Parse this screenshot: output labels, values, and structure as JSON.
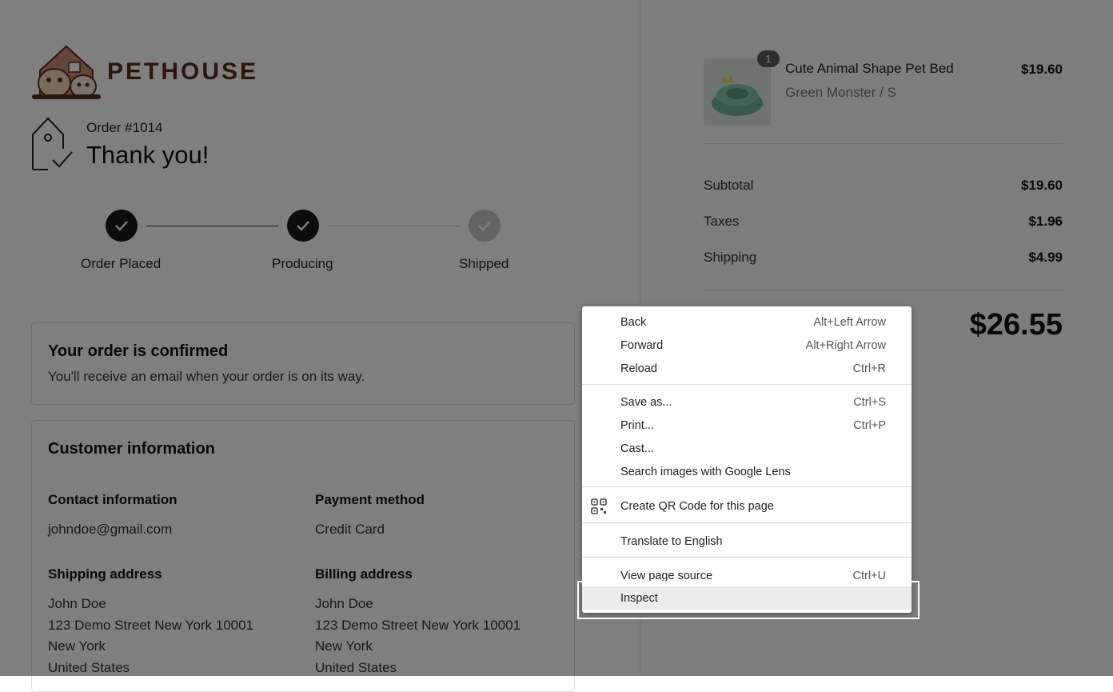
{
  "brand": {
    "name": "PETHOUSE"
  },
  "order": {
    "number": "Order #1014",
    "thanks": "Thank you!"
  },
  "progress": [
    {
      "label": "Order Placed",
      "done": true
    },
    {
      "label": "Producing",
      "done": true
    },
    {
      "label": "Shipped",
      "done": false
    }
  ],
  "confirm": {
    "title": "Your order is confirmed",
    "text": "You'll receive an email when your order is on its way."
  },
  "customer": {
    "title": "Customer information",
    "contact": {
      "heading": "Contact information",
      "value": "johndoe@gmail.com"
    },
    "payment": {
      "heading": "Payment method",
      "value": "Credit Card"
    },
    "shipping": {
      "heading": "Shipping address",
      "lines": [
        "John Doe",
        "123 Demo Street New York 10001",
        "New York",
        "United States"
      ]
    },
    "billing": {
      "heading": "Billing address",
      "lines": [
        "John Doe",
        "123 Demo Street New York 10001",
        "New York",
        "United States"
      ]
    }
  },
  "summary": {
    "item": {
      "name": "Cute Animal Shape Pet Bed",
      "variant": "Green Monster / S",
      "price": "$19.60",
      "qty": "1"
    },
    "subtotal": {
      "label": "Subtotal",
      "value": "$19.60"
    },
    "taxes": {
      "label": "Taxes",
      "value": "$1.96"
    },
    "shipping": {
      "label": "Shipping",
      "value": "$4.99"
    },
    "total": "$26.55"
  },
  "context_menu": {
    "items": [
      {
        "label": "Back",
        "shortcut": "Alt+Left Arrow"
      },
      {
        "label": "Forward",
        "shortcut": "Alt+Right Arrow"
      },
      {
        "label": "Reload",
        "shortcut": "Ctrl+R"
      },
      {
        "label": "Save as...",
        "shortcut": "Ctrl+S"
      },
      {
        "label": "Print...",
        "shortcut": "Ctrl+P"
      },
      {
        "label": "Cast...",
        "shortcut": ""
      },
      {
        "label": "Search images with Google Lens",
        "shortcut": ""
      },
      {
        "label": "Create QR Code for this page",
        "shortcut": "",
        "icon": "qr-code-icon"
      },
      {
        "label": "Translate to English",
        "shortcut": ""
      },
      {
        "label": "View page source",
        "shortcut": "Ctrl+U"
      },
      {
        "label": "Inspect",
        "shortcut": ""
      }
    ]
  },
  "colors": {
    "brand": "#5a2a24",
    "step_done": "#1a1a1a",
    "step_pending": "#c6c6c6"
  }
}
